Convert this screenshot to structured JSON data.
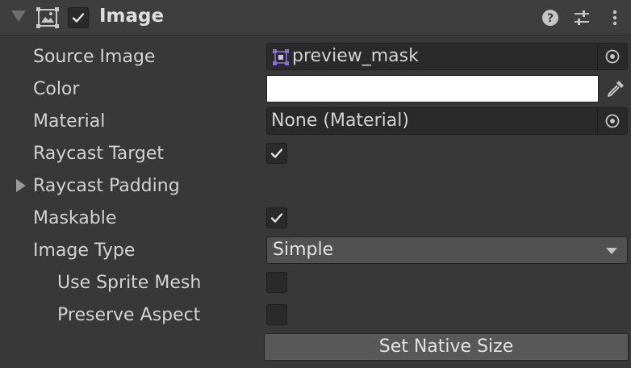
{
  "header": {
    "title": "Image",
    "enabled": true,
    "help_icon": "help-icon",
    "presets_icon": "presets-sliders-icon",
    "menu_icon": "kebab-menu-icon"
  },
  "properties": {
    "source_image": {
      "label": "Source Image",
      "value": "preview_mask",
      "icon": "sprite-icon"
    },
    "color": {
      "label": "Color",
      "value": "#ffffff"
    },
    "material": {
      "label": "Material",
      "value": "None (Material)"
    },
    "raycast_target": {
      "label": "Raycast Target",
      "checked": true
    },
    "raycast_padding": {
      "label": "Raycast Padding",
      "expanded": false
    },
    "maskable": {
      "label": "Maskable",
      "checked": true
    },
    "image_type": {
      "label": "Image Type",
      "value": "Simple"
    },
    "use_sprite_mesh": {
      "label": "Use Sprite Mesh",
      "checked": false
    },
    "preserve_aspect": {
      "label": "Preserve Aspect",
      "checked": false
    }
  },
  "buttons": {
    "set_native_size": "Set Native Size"
  },
  "colors": {
    "panel_bg": "#383838",
    "header_bg": "#3e3e3e",
    "field_bg": "#2a2a2a",
    "sprite_icon_accent": "#8b6fd6"
  }
}
